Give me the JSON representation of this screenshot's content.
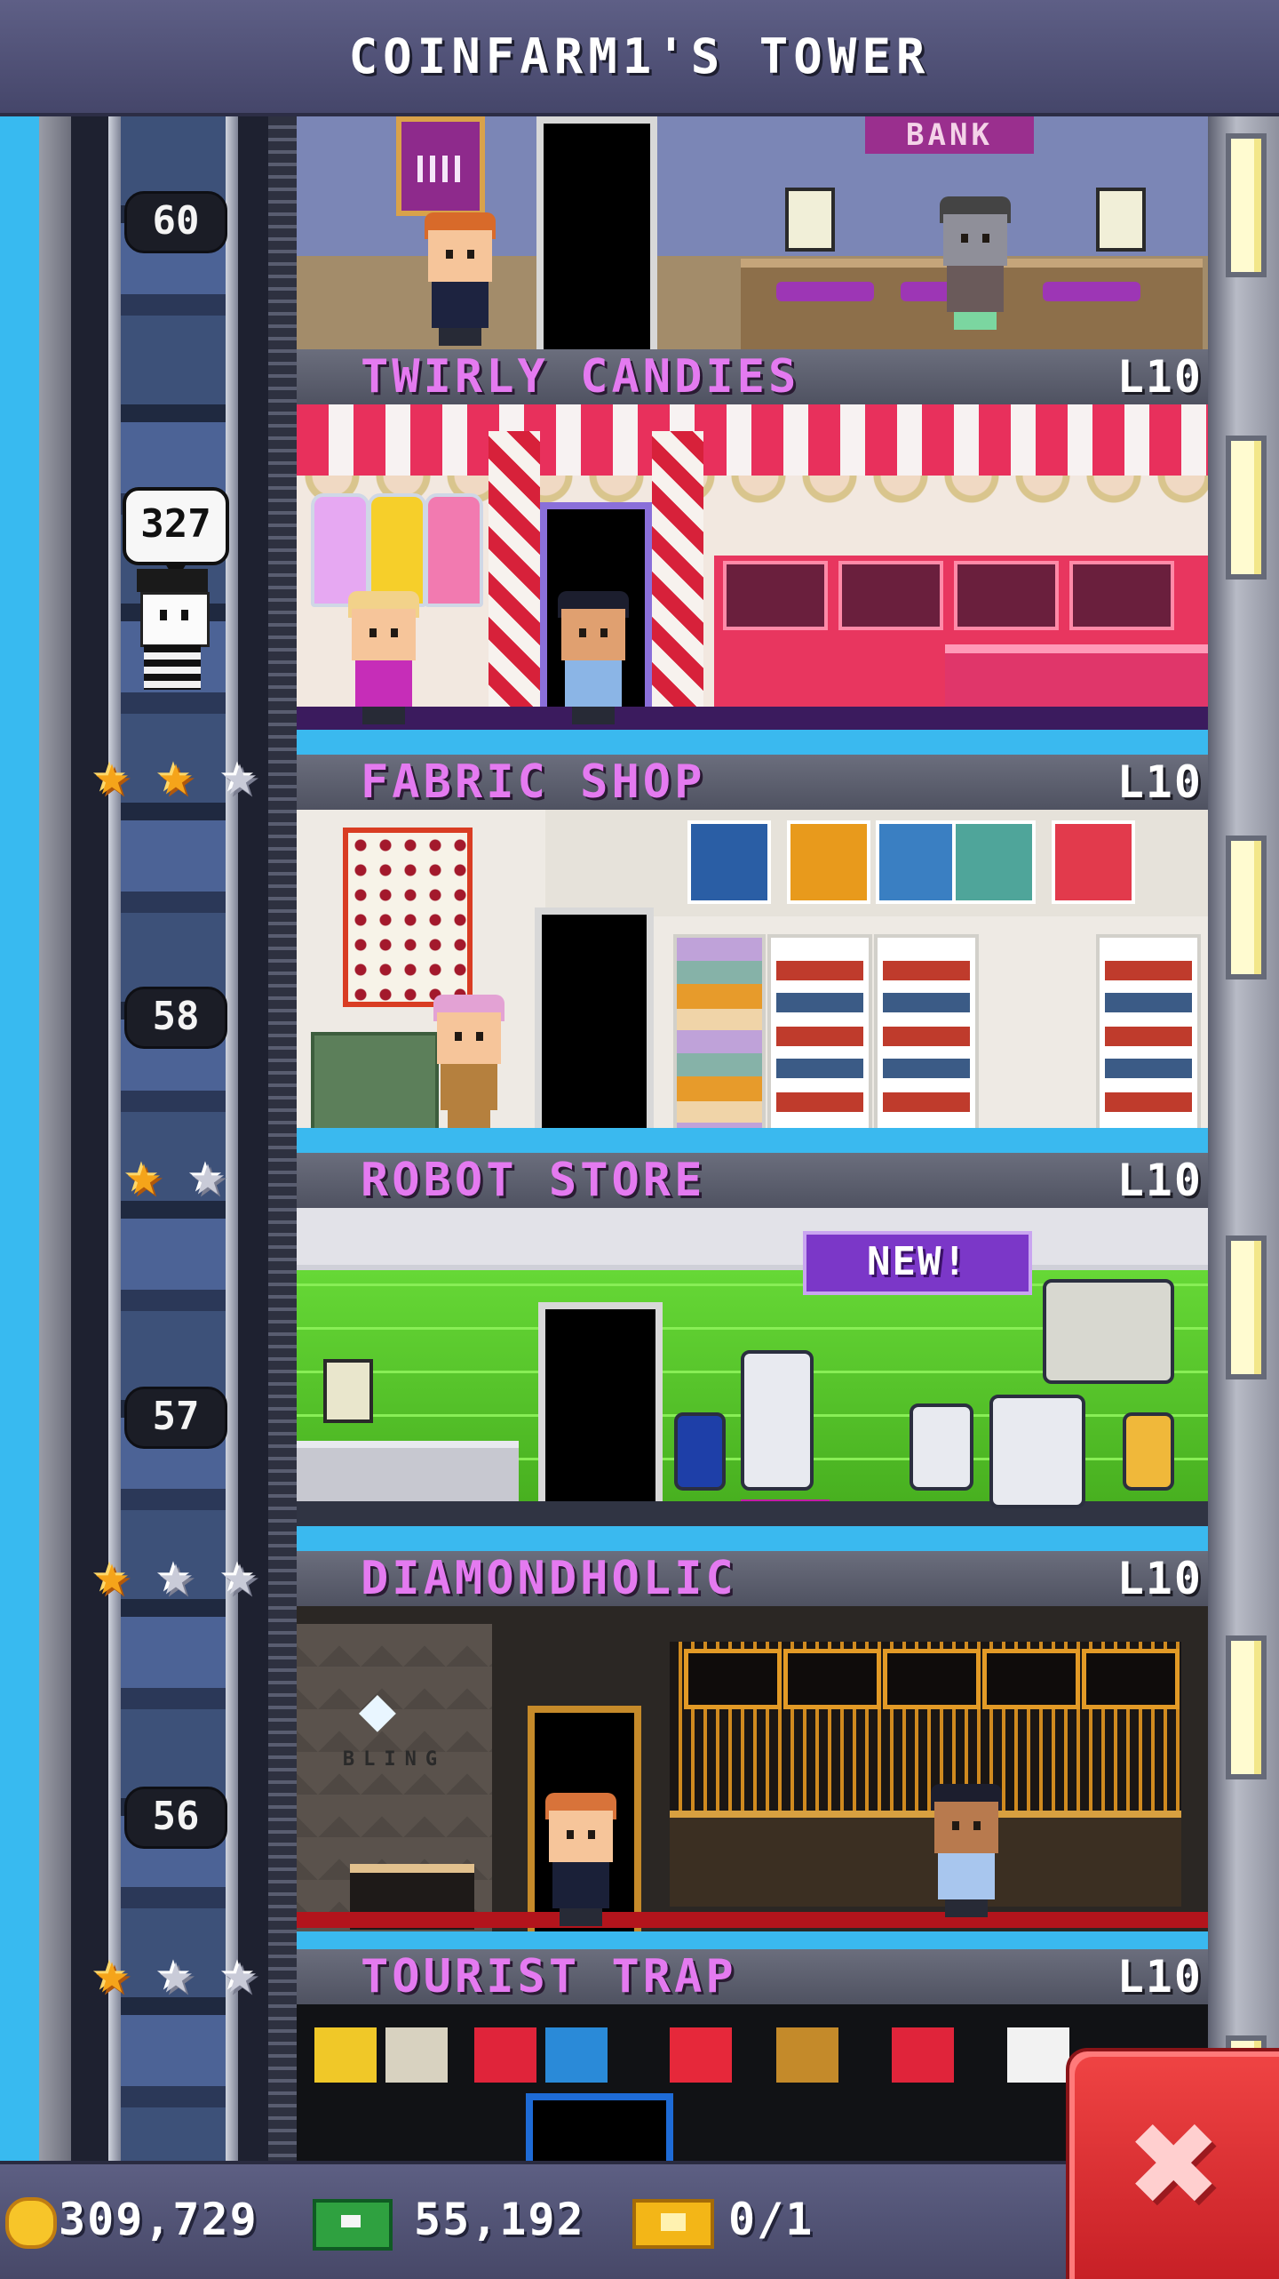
{
  "header": {
    "title": "COINFARM1'S TOWER"
  },
  "elevator": {
    "floor_numbers": [
      "60",
      "58",
      "57",
      "56"
    ],
    "visitor_bubble": "327"
  },
  "floors": [
    {
      "name": "TWIRLY CANDIES",
      "level": "L10",
      "stars_gold": 2,
      "stars_total": 3
    },
    {
      "name": "FABRIC SHOP",
      "level": "L10",
      "stars_gold": 1,
      "stars_total": 2
    },
    {
      "name": "ROBOT STORE",
      "level": "L10",
      "stars_gold": 1,
      "stars_total": 3,
      "badge": "NEW!"
    },
    {
      "name": "DIAMONDHOLIC",
      "level": "L10",
      "stars_gold": 1,
      "stars_total": 3
    },
    {
      "name": "TOURIST TRAP",
      "level": "L10"
    }
  ],
  "bank_room": {
    "sign": "BANK"
  },
  "diamond_room": {
    "logo_text": "BLING"
  },
  "stars_symbol": "★",
  "resources": {
    "coins": "309,729",
    "bux": "55,192",
    "tickets": "0/1"
  },
  "close_button": {
    "symbol": "✖"
  },
  "colors": {
    "label_name": "#e47af0",
    "star_gold": "#f5a41a",
    "star_silver": "#c9cbd8",
    "close_red": "#e53238"
  },
  "icons": [
    "coin-icon",
    "bux-icon",
    "ticket-icon",
    "star-icon",
    "close-icon"
  ]
}
